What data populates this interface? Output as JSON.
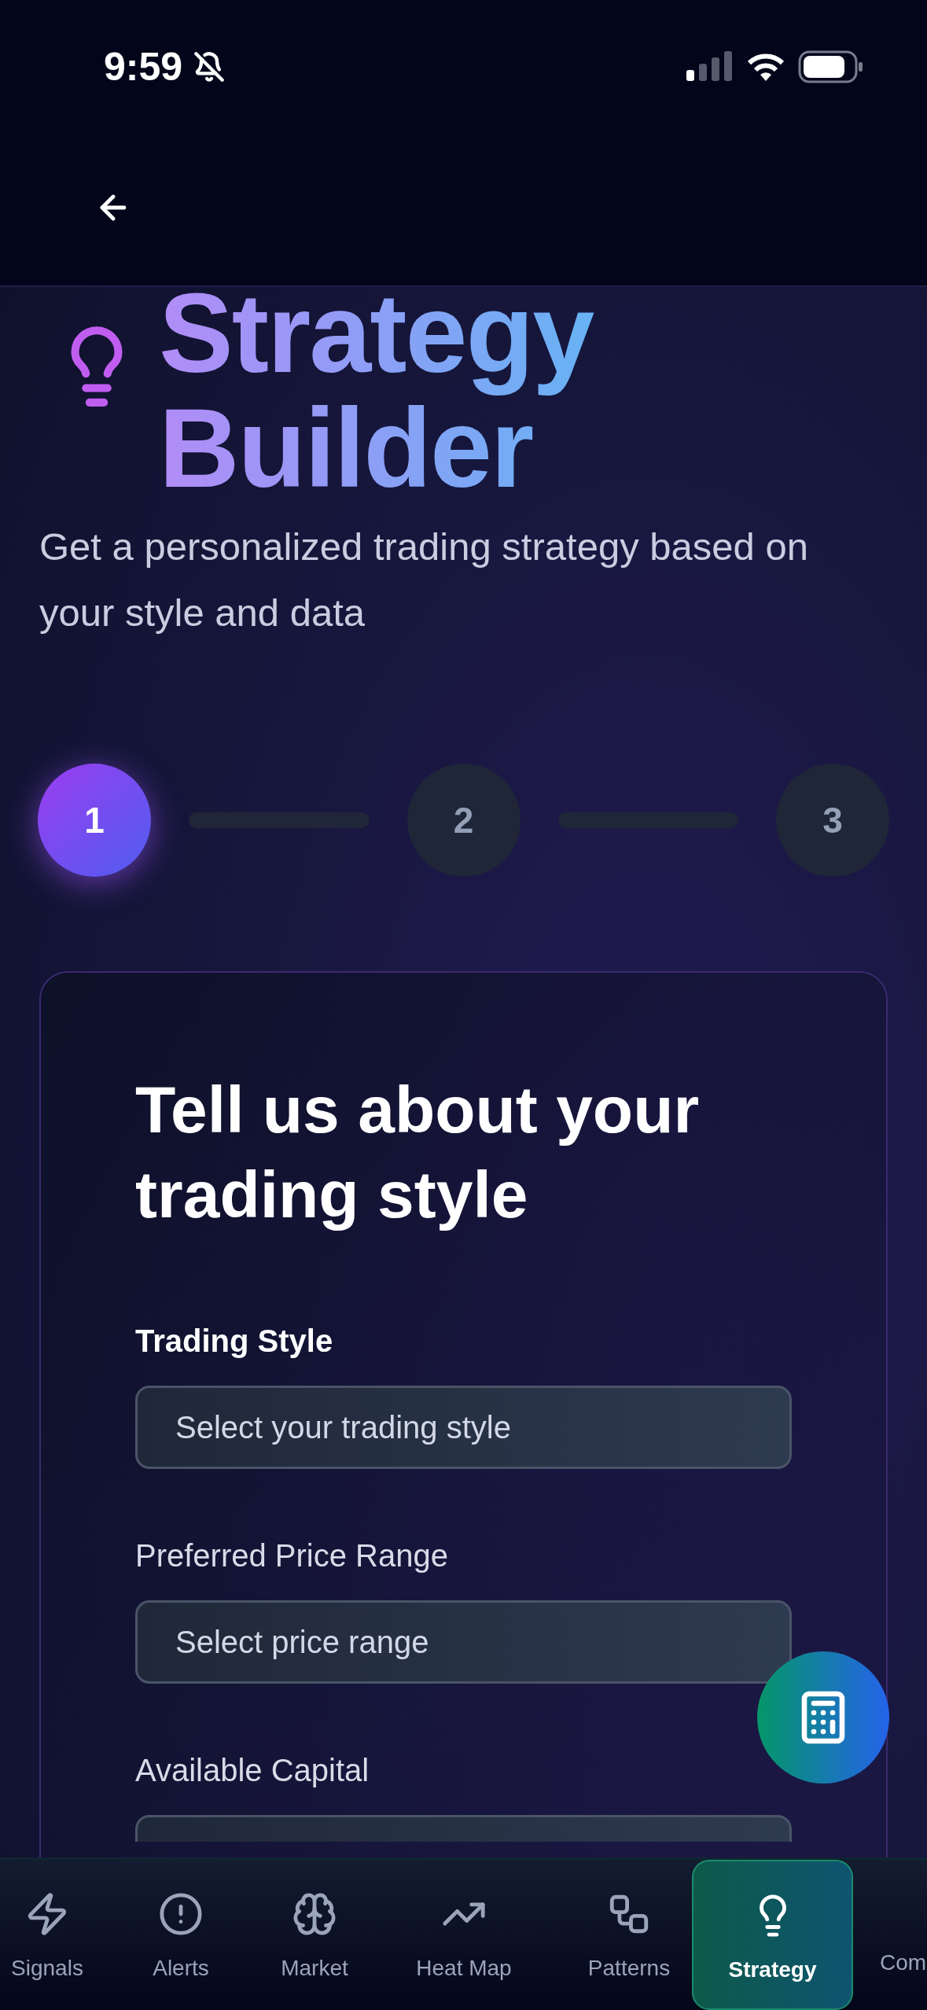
{
  "status_bar": {
    "time": "9:59"
  },
  "title": "Strategy Builder",
  "subtitle": "Get a personalized trading strategy based on your style and data",
  "steps": [
    {
      "label": "1",
      "selected": true
    },
    {
      "label": "2",
      "selected": false
    },
    {
      "label": "3",
      "selected": false
    }
  ],
  "card": {
    "heading": "Tell us about your trading style",
    "fields": [
      {
        "label": "Trading Style",
        "strong": true,
        "placeholder": "Select your trading style"
      },
      {
        "label": "Preferred Price Range",
        "strong": false,
        "placeholder": "Select price range"
      },
      {
        "label": "Available Capital",
        "strong": false
      }
    ]
  },
  "nav": [
    {
      "label": "Signals",
      "selected": false
    },
    {
      "label": "Alerts",
      "selected": false
    },
    {
      "label": "Market",
      "selected": false
    },
    {
      "label": "Heat Map",
      "selected": false
    },
    {
      "label": "Patterns",
      "selected": false
    },
    {
      "label": "Strategy",
      "selected": true
    },
    {
      "label": "Com",
      "selected": false
    }
  ]
}
